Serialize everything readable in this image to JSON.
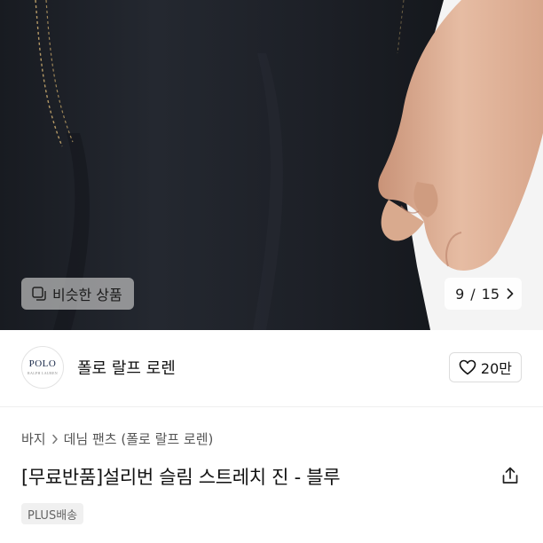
{
  "photo": {
    "similar_button": {
      "label": "비슷한 상품",
      "icon": "similar-products-icon"
    },
    "counter": {
      "current": "9",
      "separator": "/",
      "total": "15",
      "icon": "chevron-right-icon"
    }
  },
  "brand": {
    "logo_text": "POLO",
    "logo_subtext": "RALPH LAUREN",
    "name": "폴로 랄프 로렌",
    "likes": {
      "count": "20만",
      "icon": "heart-outline-icon"
    }
  },
  "breadcrumb": {
    "items": [
      "바지",
      "데님 팬츠 (폴로 랄프 로렌)"
    ],
    "separator_icon": "chevron-right-icon"
  },
  "product": {
    "title": "[무료반품]설리번 슬림 스트레치 진 - 블루",
    "share_icon": "share-icon",
    "badge": "PLUS배송"
  },
  "colors": {
    "denim": "#1b1e24",
    "skin": "#e0b59c",
    "badge_bg": "#f0f0f0"
  }
}
